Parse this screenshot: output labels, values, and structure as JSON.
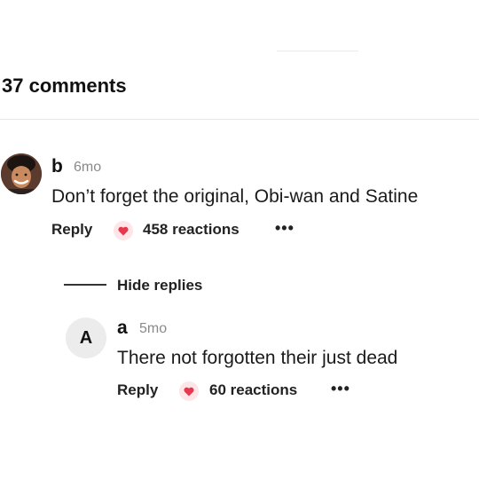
{
  "header": {
    "count_label": "37 comments"
  },
  "comments": [
    {
      "author": "b",
      "time": "6mo",
      "text": "Don’t forget the original, Obi-wan and Satine",
      "reply_label": "Reply",
      "reactions_label": "458 reactions",
      "more_label": "•••",
      "avatar": "profile-photo"
    }
  ],
  "replies_toggle": {
    "label": "Hide replies"
  },
  "replies": [
    {
      "author": "a",
      "avatar_letter": "A",
      "time": "5mo",
      "text": "There not forgotten their just dead",
      "reply_label": "Reply",
      "reactions_label": "60 reactions",
      "more_label": "•••"
    }
  ],
  "colors": {
    "reaction_bg": "#fde5e8",
    "heart": "#e63950",
    "muted": "#8a8a8a"
  },
  "icons": {
    "reaction": "heart-icon",
    "more": "more-options-icon"
  }
}
